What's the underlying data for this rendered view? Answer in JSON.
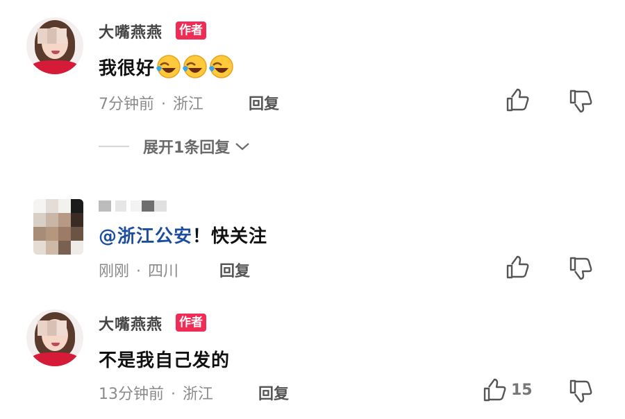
{
  "comments": [
    {
      "username": "大嘴燕燕",
      "badge": "作者",
      "content": "我很好",
      "emoji_name": "laughing-crying-emoji",
      "emoji_count": 3,
      "time": "7分钟前",
      "location": "浙江",
      "reply_label": "回复",
      "expand_label": "展开1条回复"
    },
    {
      "username": "",
      "mention": "@浙江公安",
      "content": "！快关注",
      "time": "刚刚",
      "location": "四川",
      "reply_label": "回复"
    },
    {
      "username": "大嘴燕燕",
      "badge": "作者",
      "content": "不是我自己发的",
      "time": "13分钟前",
      "location": "浙江",
      "reply_label": "回复",
      "like_count": "15"
    }
  ],
  "separator": "·",
  "icons": {
    "like": "thumbs-up-icon",
    "dislike": "thumbs-down-icon",
    "expand": "chevron-down-icon"
  },
  "colors": {
    "author_badge": "#f02c56",
    "mention": "#1d4e9e",
    "meta_text": "#8a8a8a"
  }
}
